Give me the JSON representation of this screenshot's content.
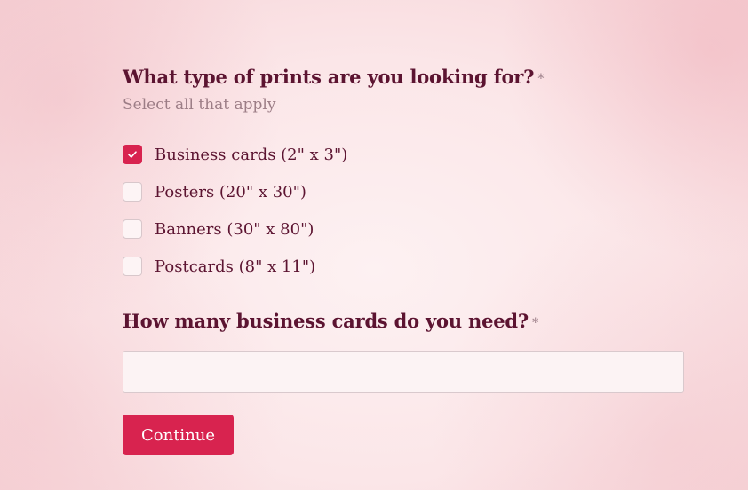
{
  "question1": {
    "text": "What type of prints are you looking for?",
    "required_marker": "*",
    "hint": "Select all that apply",
    "options": [
      {
        "label": "Business cards (2\" x 3\")",
        "checked": true
      },
      {
        "label": "Posters (20\" x 30\")",
        "checked": false
      },
      {
        "label": "Banners (30\" x 80\")",
        "checked": false
      },
      {
        "label": "Postcards (8\" x 11\")",
        "checked": false
      }
    ]
  },
  "question2": {
    "text": "How many business cards do you need?",
    "required_marker": "*",
    "value": "",
    "placeholder": ""
  },
  "continue_label": "Continue",
  "colors": {
    "accent": "#d8234f",
    "text": "#5c1431",
    "muted": "#9c7d86"
  }
}
